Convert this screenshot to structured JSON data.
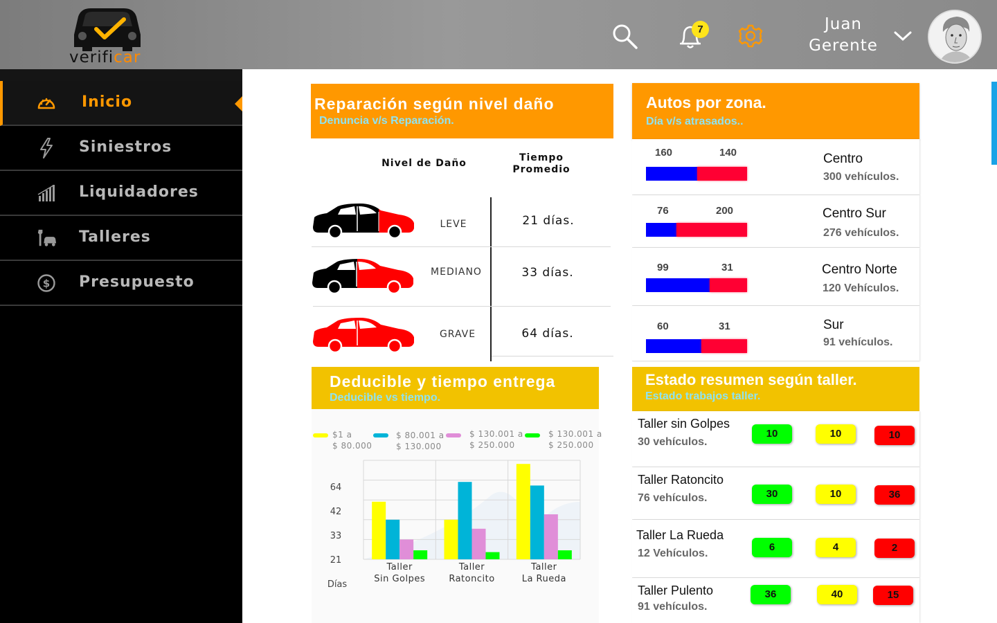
{
  "header": {
    "logo_text_a": "verifi",
    "logo_text_b": "car",
    "notification_count": "7",
    "user_first_name": "Juan",
    "user_role": "Gerente"
  },
  "sidebar": {
    "items": [
      {
        "label": "Inicio",
        "icon": "speedometer-icon",
        "active": true
      },
      {
        "label": "Siniestros",
        "icon": "lightning-icon",
        "active": false
      },
      {
        "label": "Liquidadores",
        "icon": "bar-signal-icon",
        "active": false
      },
      {
        "label": "Talleres",
        "icon": "wrench-car-icon",
        "active": false
      },
      {
        "label": "Presupuesto",
        "icon": "dollar-circle-icon",
        "active": false
      }
    ]
  },
  "reparacion": {
    "title": "Reparación según nivel daño",
    "subtitle": "Denuncia v/s Reparación.",
    "col_level": "Nivel de Daño",
    "col_time_a": "Tiempo",
    "col_time_b": "Promedio",
    "rows": [
      {
        "level": "LEVE",
        "time": "21 días."
      },
      {
        "level": "MEDIANO",
        "time": "33 días."
      },
      {
        "level": "GRAVE",
        "time": "64 días."
      }
    ]
  },
  "zonas": {
    "title": "Autos por zona.",
    "subtitle": "Día v/s atrasados..",
    "rows": [
      {
        "day": "160",
        "late": "140",
        "name": "Centro",
        "count": "300 vehículos."
      },
      {
        "day": "76",
        "late": "200",
        "name": "Centro Sur",
        "count": "276 vehículos."
      },
      {
        "day": "99",
        "late": "31",
        "name": "Centro Norte",
        "count": "120 Vehículos."
      },
      {
        "day": "60",
        "late": "31",
        "name": "Sur",
        "count": "91 vehículos."
      }
    ]
  },
  "deducible": {
    "title": "Deducible y tiempo entrega",
    "subtitle": "Deducible vs tiempo.",
    "legend": [
      {
        "a": "$1 a",
        "b": "$ 80.000",
        "color": "#ffff00"
      },
      {
        "a": "$ 80.001 a",
        "b": "$ 130.000",
        "color": "#00b4d8"
      },
      {
        "a": "$ 130.001 a",
        "b": "$ 250.000",
        "color": "#e08ed8"
      },
      {
        "a": "$ 130.001 a",
        "b": "$ 250.000",
        "color": "#00ff00"
      }
    ]
  },
  "chart_data": {
    "type": "bar",
    "categories": [
      [
        "Taller",
        "Sin Golpes"
      ],
      [
        "Taller",
        "Ratoncito"
      ],
      [
        "Taller",
        "La Rueda"
      ]
    ],
    "y_ticks": [
      "64",
      "42",
      "33",
      "21"
    ],
    "ylabel": "Días",
    "ylim": [
      15,
      70
    ],
    "series": [
      {
        "name": "$1 a $ 80.000",
        "color": "#ffff00",
        "values": [
          47,
          37,
          68
        ]
      },
      {
        "name": "$ 80.001 a $ 130.000",
        "color": "#00b4d8",
        "values": [
          37,
          58,
          56
        ]
      },
      {
        "name": "$ 130.001 a $ 250.000",
        "color": "#e08ed8",
        "values": [
          26,
          32,
          40
        ]
      },
      {
        "name": "$ 130.001 a $ 250.000",
        "color": "#00ff00",
        "values": [
          20,
          19,
          20
        ]
      }
    ]
  },
  "talleres": {
    "title": "Estado resumen según taller.",
    "subtitle": "Estado trabajos taller.",
    "rows": [
      {
        "name": "Taller sin Golpes",
        "count": "30 vehículos.",
        "green": "10",
        "yellow": "10",
        "red": "10"
      },
      {
        "name": "Taller Ratoncito",
        "count": "76 vehículos.",
        "green": "30",
        "yellow": "10",
        "red": "36"
      },
      {
        "name": "Taller La Rueda",
        "count": "12 Vehículos.",
        "green": "6",
        "yellow": "4",
        "red": "2"
      },
      {
        "name": "Taller Pulento",
        "count": "91 vehículos.",
        "green": "36",
        "yellow": "40",
        "red": "15"
      }
    ]
  },
  "colors": {
    "accent_orange": "#ff9800",
    "accent_yellow": "#f2c200",
    "bar_blue": "#0000ff",
    "bar_red": "#ff0033"
  }
}
